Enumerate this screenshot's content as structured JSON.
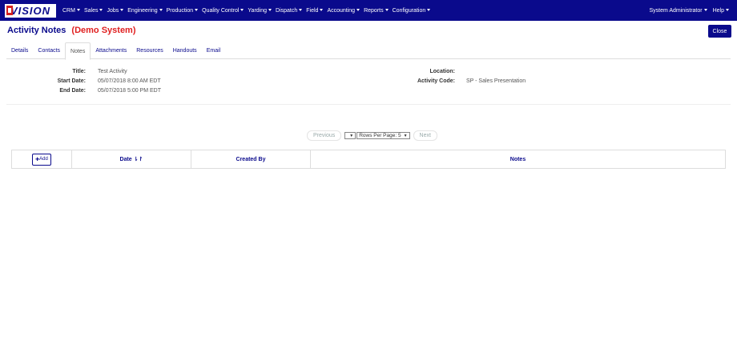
{
  "nav": {
    "logo_text": "VISION",
    "menu": [
      "CRM",
      "Sales",
      "Jobs",
      "Engineering",
      "Production",
      "Quality Control",
      "Yarding",
      "Dispatch",
      "Field",
      "Accounting",
      "Reports",
      "Configuration"
    ],
    "user": "System Administrator",
    "help": "Help"
  },
  "header": {
    "title": "Activity Notes",
    "demo": "(Demo System)",
    "close_label": "Close"
  },
  "tabs": [
    "Details",
    "Contacts",
    "Notes",
    "Attachments",
    "Resources",
    "Handouts",
    "Email"
  ],
  "active_tab": "Notes",
  "details": {
    "title_label": "Title:",
    "title_value": "Test Activity",
    "start_label": "Start Date:",
    "start_value": "05/07/2018 8:00 AM EDT",
    "end_label": "End Date:",
    "end_value": "05/07/2018 5:00 PM EDT",
    "location_label": "Location:",
    "location_value": "",
    "code_label": "Activity Code:",
    "code_value": "SP - Sales Presentation"
  },
  "pager": {
    "previous": "Previous",
    "page_select": "",
    "rows_select": "Rows Per Page: 5",
    "next": "Next"
  },
  "table": {
    "add_label": "Add",
    "columns": [
      "Date",
      "Created By",
      "Notes"
    ]
  },
  "colors": {
    "brand": "#0a0a8c",
    "demo_red": "#e02020"
  }
}
